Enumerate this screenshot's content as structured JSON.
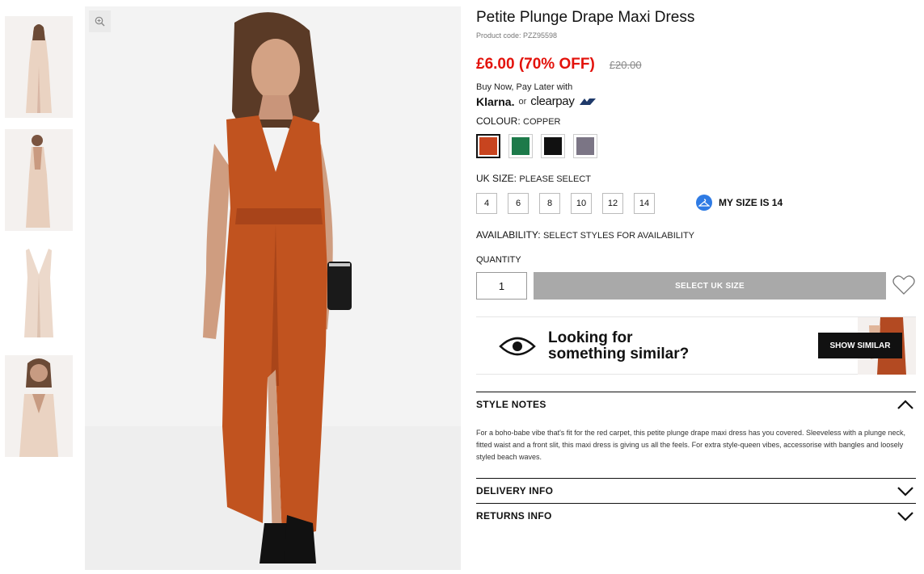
{
  "product": {
    "title": "Petite Plunge Drape Maxi Dress",
    "code_label": "Product code: PZZ95598",
    "price_now": "£6.00 (70% OFF)",
    "price_was": "£20.00"
  },
  "payment": {
    "intro": "Buy Now, Pay Later with",
    "klarna": "Klarna.",
    "or": "or",
    "clearpay": "clearpay"
  },
  "colour": {
    "label": "COLOUR:",
    "value": "COPPER",
    "swatches": [
      {
        "name": "copper",
        "hex": "#c8441f"
      },
      {
        "name": "green",
        "hex": "#1d7a4a"
      },
      {
        "name": "black",
        "hex": "#111111"
      },
      {
        "name": "grey",
        "hex": "#7b7585"
      }
    ],
    "selected_index": 0
  },
  "size": {
    "label": "UK SIZE:",
    "value": "PLEASE SELECT",
    "options": [
      "4",
      "6",
      "8",
      "10",
      "12",
      "14"
    ],
    "my_size": "MY SIZE IS 14"
  },
  "availability": {
    "label": "AVAILABILITY:",
    "value": "SELECT STYLES FOR AVAILABILITY"
  },
  "quantity": {
    "label": "QUANTITY",
    "value": "1"
  },
  "add_button": "SELECT UK SIZE",
  "similar": {
    "line1": "Looking for",
    "line2": "something similar?",
    "button": "SHOW SIMILAR"
  },
  "accordion": {
    "style_notes": "STYLE NOTES",
    "style_notes_text": "For a boho-babe vibe that's fit for the red carpet, this petite plunge drape maxi dress has you covered. Sleeveless with a plunge neck, fitted waist and a front slit, this maxi dress is giving us all the feels. For extra style-queen vibes, accessorise with bangles and loosely styled beach waves.",
    "delivery": "DELIVERY INFO",
    "returns": "RETURNS INFO"
  },
  "colors": {
    "sale_red": "#e3120b",
    "klarna_blue": "#2f7be4",
    "dress_copper": "#c1531f",
    "dress_nude": "#ead3c2"
  }
}
